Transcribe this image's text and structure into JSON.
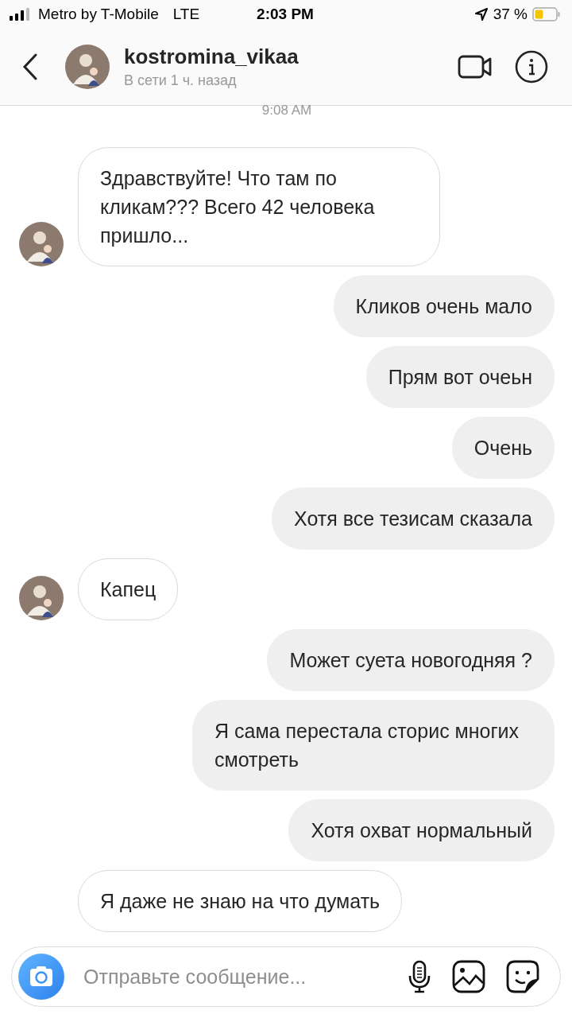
{
  "status_bar": {
    "carrier": "Metro by T-Mobile",
    "network": "LTE",
    "time": "2:03 PM",
    "battery": "37 %"
  },
  "header": {
    "username": "kostromina_vikaa",
    "presence": "В сети 1 ч. назад"
  },
  "timestamp": "9:08 AM",
  "messages": [
    {
      "kind": "received",
      "avatar": true,
      "text": "Здравствуйте! Что там по кликам??? Всего 42 человека пришло..."
    },
    {
      "kind": "sent",
      "text": "Кликов очень мало"
    },
    {
      "kind": "sent",
      "text": "Прям вот очеьн"
    },
    {
      "kind": "sent",
      "text": "Очень"
    },
    {
      "kind": "sent",
      "text": "Хотя все тезисам сказала"
    },
    {
      "kind": "received",
      "avatar": true,
      "text": "Капец"
    },
    {
      "kind": "sent",
      "text": "Может суета новогодняя ?"
    },
    {
      "kind": "sent",
      "text": "Я сама перестала сторис многих смотреть"
    },
    {
      "kind": "sent",
      "text": "Хотя охват нормальный"
    },
    {
      "kind": "received",
      "avatar": false,
      "text": "Я даже не знаю на что думать"
    }
  ],
  "composer": {
    "placeholder": "Отправьте сообщение..."
  }
}
